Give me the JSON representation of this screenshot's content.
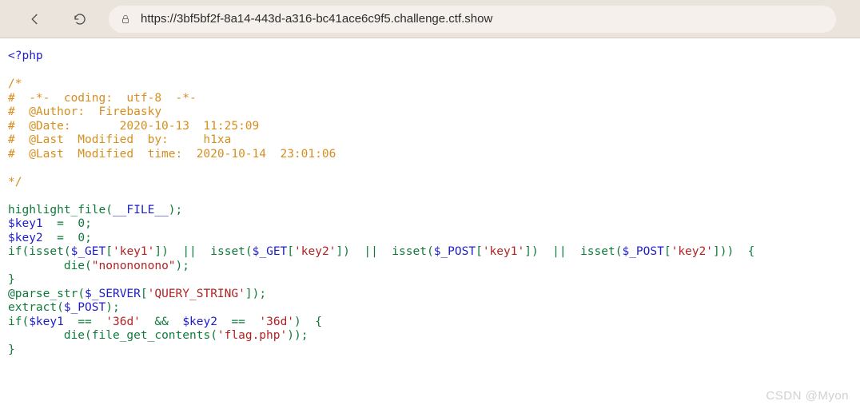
{
  "browser": {
    "url": "https://3bf5bf2f-8a14-443d-a316-bc41ace6c9f5.challenge.ctf.show"
  },
  "code": {
    "php_open": "<?php",
    "comment_open": "/*",
    "c1": "#  -*-  coding:  utf-8  -*-",
    "c2": "#  @Author:  Firebasky",
    "c3": "#  @Date:       2020-10-13  11:25:09",
    "c4": "#  @Last  Modified  by:     h1xa",
    "c5": "#  @Last  Modified  time:  2020-10-14  23:01:06",
    "comment_close": "*/",
    "fn_highlight": "highlight_file",
    "const_file": "__FILE__",
    "var_key1": "$key1",
    "var_key2": "$key2",
    "zero": "0",
    "kw_if": "if",
    "fn_isset": "isset",
    "var_get": "$_GET",
    "var_post": "$_POST",
    "str_key1": "'key1'",
    "str_key2": "'key2'",
    "op_or": "||",
    "fn_die": "die",
    "str_nono": "\"nonononono\"",
    "at": "@",
    "fn_parse_str": "parse_str",
    "var_server": "$_SERVER",
    "str_qs": "'QUERY_STRING'",
    "fn_extract": "extract",
    "op_eq": "==",
    "str_36d": "'36d'",
    "op_and": "&&",
    "fn_fgc": "file_get_contents",
    "str_flag": "'flag.php'",
    "semi": ";",
    "eqsign": "=",
    "lparen": "(",
    "rparen": ")",
    "lbrace": "{",
    "rbrace": "}",
    "lbrack": "[",
    "rbrack": "]"
  },
  "watermark": "CSDN @Myon"
}
